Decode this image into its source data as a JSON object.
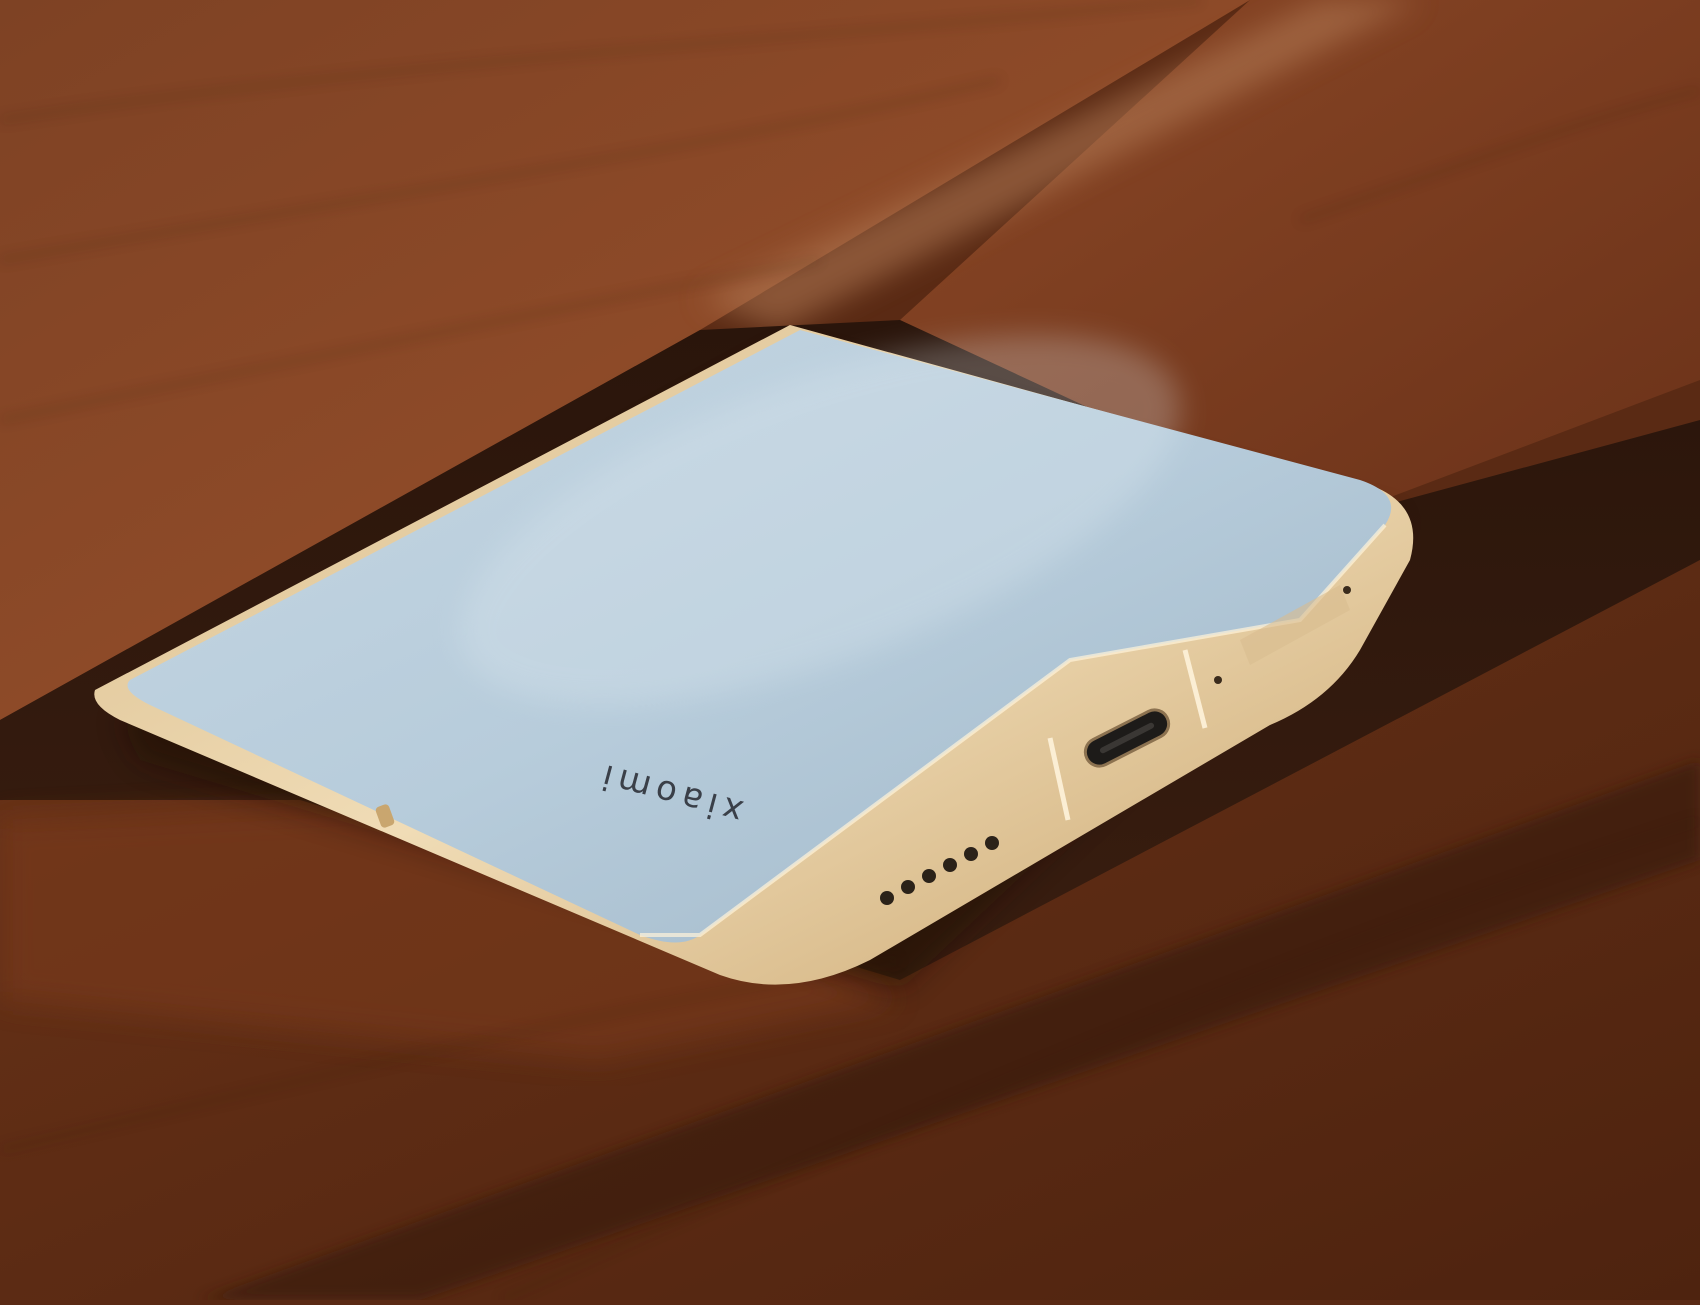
{
  "photo": {
    "subject": "smartphone-bottom-edge",
    "logo_text": "xiaomi",
    "colors": {
      "wood_dark": "#4a2210",
      "wood_mid": "#7a3c1e",
      "wood_light": "#9a5430",
      "phone_back": "#b9cfde",
      "frame_gold": "#e6cfa6",
      "frame_shadow": "#b79565"
    },
    "ports": {
      "speaker_grille_holes": 6,
      "usb_port": "usb-c-port",
      "sim_tray": "sim-tray"
    }
  }
}
